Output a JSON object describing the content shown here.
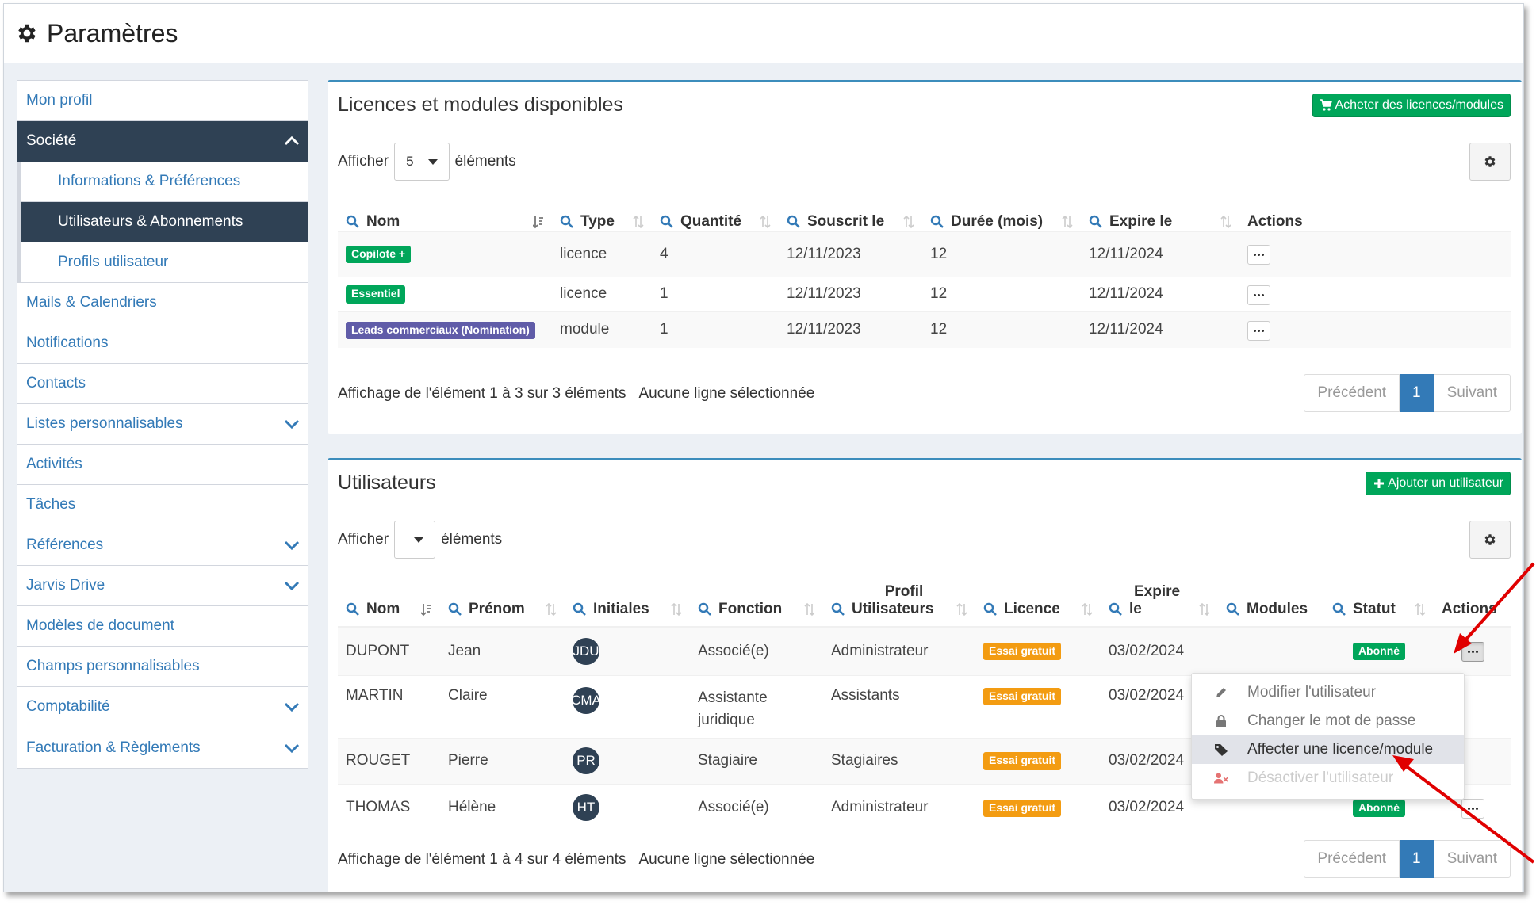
{
  "page": {
    "title": "Paramètres"
  },
  "sidebar": {
    "items": [
      {
        "label": "Mon profil"
      },
      {
        "label": "Société"
      },
      {
        "label": "Informations & Préférences"
      },
      {
        "label": "Utilisateurs & Abonnements"
      },
      {
        "label": "Profils utilisateur"
      },
      {
        "label": "Mails & Calendriers"
      },
      {
        "label": "Notifications"
      },
      {
        "label": "Contacts"
      },
      {
        "label": "Listes personnalisables"
      },
      {
        "label": "Activités"
      },
      {
        "label": "Tâches"
      },
      {
        "label": "Références"
      },
      {
        "label": "Jarvis Drive"
      },
      {
        "label": "Modèles de document"
      },
      {
        "label": "Champs personnalisables"
      },
      {
        "label": "Comptabilité"
      },
      {
        "label": "Facturation & Règlements"
      }
    ]
  },
  "licences": {
    "title": "Licences et modules disponibles",
    "buy_button": "Acheter des licences/modules",
    "show_prefix": "Afficher",
    "show_value": "5",
    "show_suffix": "éléments",
    "columns": [
      "Nom",
      "Type",
      "Quantité",
      "Souscrit le",
      "Durée (mois)",
      "Expire le",
      "Actions"
    ],
    "rows": [
      {
        "name": "Copilote +",
        "type": "licence",
        "qty": "4",
        "subscribed": "12/11/2023",
        "duration": "12",
        "expires": "12/11/2024"
      },
      {
        "name": "Essentiel",
        "type": "licence",
        "qty": "1",
        "subscribed": "12/11/2023",
        "duration": "12",
        "expires": "12/11/2024"
      },
      {
        "name": "Leads commerciaux (Nomination)",
        "type": "module",
        "qty": "1",
        "subscribed": "12/11/2023",
        "duration": "12",
        "expires": "12/11/2024"
      }
    ],
    "info": "Affichage de l'élément 1 à 3 sur 3 éléments",
    "selection": "Aucune ligne sélectionnée",
    "pager": {
      "prev": "Précédent",
      "page": "1",
      "next": "Suivant"
    }
  },
  "users": {
    "title": "Utilisateurs",
    "add_button": "Ajouter un utilisateur",
    "show_prefix": "Afficher",
    "show_value": "",
    "show_suffix": "éléments",
    "columns": {
      "nom": "Nom",
      "prenom": "Prénom",
      "initiales": "Initiales",
      "fonction": "Fonction",
      "profil_top": "Profil",
      "profil_bottom": "Utilisateurs",
      "licence": "Licence",
      "expire_top": "Expire",
      "expire_bottom": "le",
      "modules": "Modules",
      "statut": "Statut",
      "actions": "Actions"
    },
    "rows": [
      {
        "nom": "DUPONT",
        "prenom": "Jean",
        "initiales": "JDU",
        "fonction": "Associé(e)",
        "fonction2": "",
        "profil": "Administrateur",
        "licence": "Essai gratuit",
        "expire": "03/02/2024",
        "statut": "Abonné"
      },
      {
        "nom": "MARTIN",
        "prenom": "Claire",
        "initiales": "CMA",
        "fonction": "Assistante",
        "fonction2": "juridique",
        "profil": "Assistants",
        "licence": "Essai gratuit",
        "expire": "03/02/2024",
        "statut": ""
      },
      {
        "nom": "ROUGET",
        "prenom": "Pierre",
        "initiales": "PR",
        "fonction": "Stagiaire",
        "fonction2": "",
        "profil": "Stagiaires",
        "licence": "Essai gratuit",
        "expire": "03/02/2024",
        "statut": ""
      },
      {
        "nom": "THOMAS",
        "prenom": "Hélène",
        "initiales": "HT",
        "fonction": "Associé(e)",
        "fonction2": "",
        "profil": "Administrateur",
        "licence": "Essai gratuit",
        "expire": "03/02/2024",
        "statut": "Abonné"
      }
    ],
    "info": "Affichage de l'élément 1 à 4 sur 4 éléments",
    "selection": "Aucune ligne sélectionnée",
    "pager": {
      "prev": "Précédent",
      "page": "1",
      "next": "Suivant"
    }
  },
  "action_menu": {
    "items": [
      {
        "label": "Modifier l'utilisateur",
        "icon": "pencil-icon"
      },
      {
        "label": "Changer le mot de passe",
        "icon": "lock-icon"
      },
      {
        "label": "Affecter une licence/module",
        "icon": "tag-icon"
      },
      {
        "label": "Désactiver l'utilisateur",
        "icon": "user-remove-icon"
      }
    ]
  },
  "colors": {
    "accent": "#3c8dbc",
    "sidebar_active": "#2f4154",
    "green": "#00a65a",
    "orange": "#f39c12",
    "purple": "#605ca8",
    "link": "#337ab7",
    "annotation": "#e00000"
  }
}
